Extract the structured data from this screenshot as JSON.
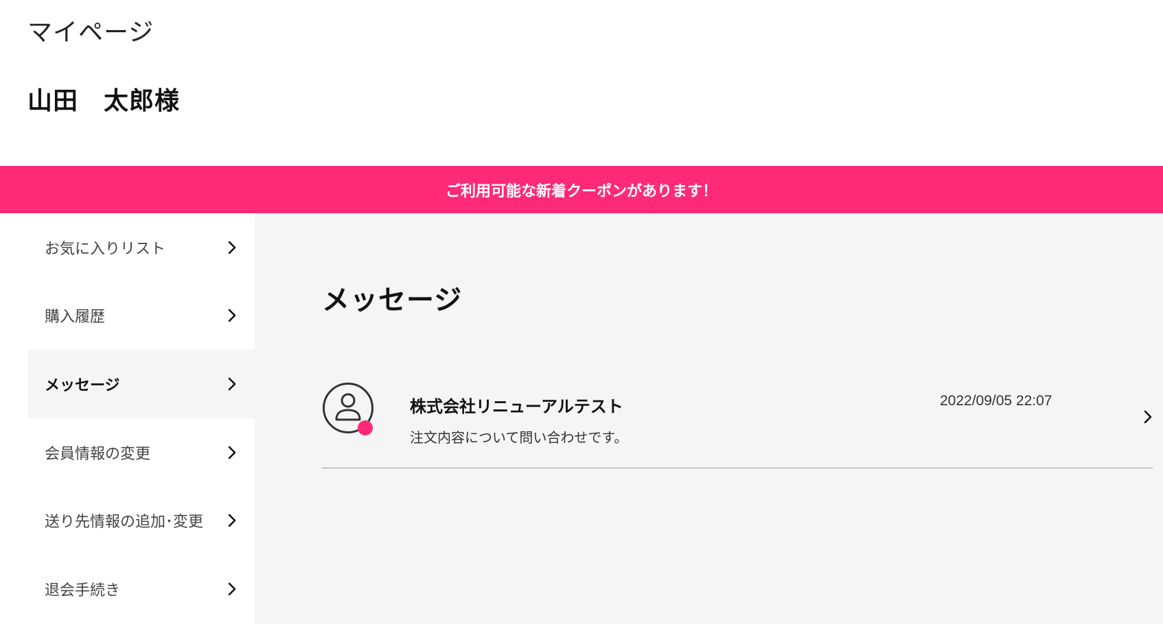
{
  "header": {
    "page_title": "マイページ",
    "user_name": "山田　太郎様"
  },
  "banner": {
    "text": "ご利用可能な新着クーポンがあります！",
    "color": "#fe2a78"
  },
  "sidebar": {
    "items": [
      {
        "label": "お気に入りリスト",
        "icon": "chevron-right-icon"
      },
      {
        "label": "購入履歴",
        "icon": "chevron-right-icon"
      },
      {
        "label": "メッセージ",
        "icon": "chevron-right-icon",
        "active": true
      },
      {
        "label": "会員情報の変更",
        "icon": "chevron-right-icon"
      },
      {
        "label": "送り先情報の追加･変更",
        "icon": "chevron-right-icon"
      },
      {
        "label": "退会手続き",
        "icon": "chevron-right-icon"
      }
    ]
  },
  "main": {
    "title": "メッセージ",
    "messages": [
      {
        "sender": "株式会社リニューアルテスト",
        "date": "2022/09/05 22:07",
        "preview": "注文内容について問い合わせです。",
        "unread": true,
        "avatar_icon": "user-circle-icon"
      }
    ]
  }
}
